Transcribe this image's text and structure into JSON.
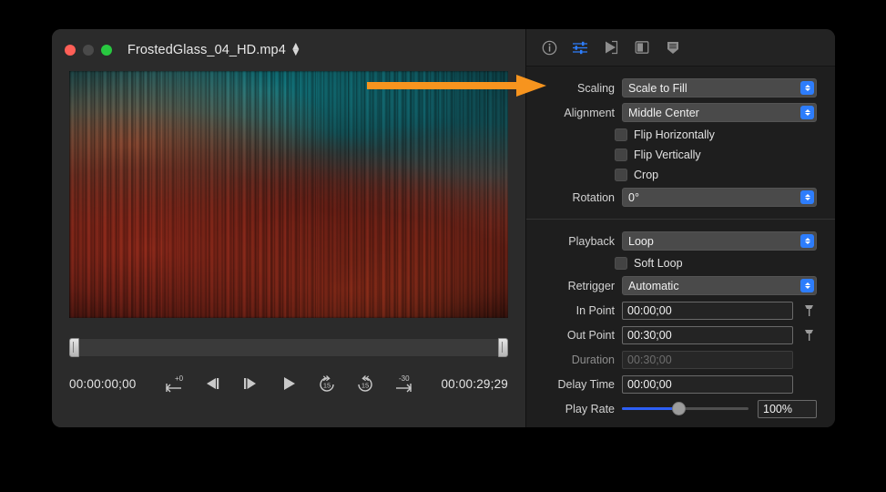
{
  "window": {
    "title": "FrostedGlass_04_HD.mp4",
    "traffic_lights": [
      "close",
      "minimize",
      "zoom"
    ]
  },
  "player": {
    "current_time": "00:00:00;00",
    "total_time": "00:00:29;29",
    "transport_buttons": [
      {
        "name": "go-to-start",
        "badge": "+0"
      },
      {
        "name": "step-backward",
        "badge": ""
      },
      {
        "name": "step-forward",
        "badge": ""
      },
      {
        "name": "play",
        "badge": ""
      },
      {
        "name": "rewind-15",
        "badge": "15"
      },
      {
        "name": "forward-15",
        "badge": "15"
      },
      {
        "name": "go-to-end",
        "badge": "-30"
      }
    ]
  },
  "inspector": {
    "toolbar": [
      {
        "name": "info-icon",
        "active": false
      },
      {
        "name": "sliders-icon",
        "active": true
      },
      {
        "name": "playback-icon",
        "active": false
      },
      {
        "name": "layout-icon",
        "active": false
      },
      {
        "name": "tag-icon",
        "active": false
      }
    ],
    "transform": {
      "scaling": {
        "label": "Scaling",
        "value": "Scale to Fill"
      },
      "alignment": {
        "label": "Alignment",
        "value": "Middle Center"
      },
      "flip_horizontally": {
        "label": "Flip Horizontally",
        "checked": false
      },
      "flip_vertically": {
        "label": "Flip Vertically",
        "checked": false
      },
      "crop": {
        "label": "Crop",
        "checked": false
      },
      "rotation": {
        "label": "Rotation",
        "value": "0°"
      }
    },
    "playback": {
      "playback": {
        "label": "Playback",
        "value": "Loop"
      },
      "soft_loop": {
        "label": "Soft Loop",
        "checked": false
      },
      "retrigger": {
        "label": "Retrigger",
        "value": "Automatic"
      },
      "in_point": {
        "label": "In Point",
        "value": "00:00;00"
      },
      "out_point": {
        "label": "Out Point",
        "value": "00:30;00"
      },
      "duration": {
        "label": "Duration",
        "value": "00:30;00",
        "disabled": true
      },
      "delay_time": {
        "label": "Delay Time",
        "value": "00:00;00"
      },
      "play_rate": {
        "label": "Play Rate",
        "value": "100%",
        "percent": 44
      }
    }
  },
  "annotation": {
    "arrow_color": "#f7941e"
  },
  "colors": {
    "accent_blue": "#2d7dfc",
    "slider_blue": "#2d5ff5",
    "panel_bg": "#1e1e1e",
    "player_bg": "#2b2b2b"
  }
}
